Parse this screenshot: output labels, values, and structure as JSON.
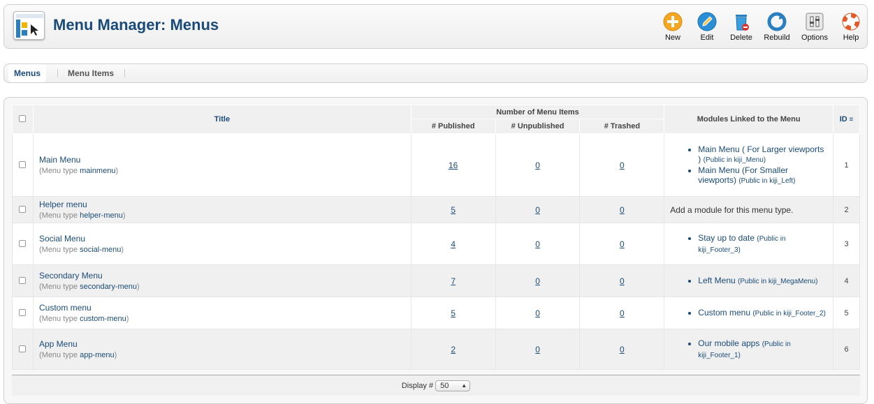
{
  "header": {
    "title": "Menu Manager: Menus",
    "logo_icon": "menu-manager-icon",
    "toolbar": [
      {
        "id": "new",
        "label": "New",
        "icon": "plus-circle-icon",
        "color": "#f39c12"
      },
      {
        "id": "edit",
        "label": "Edit",
        "icon": "pencil-icon",
        "color": "#2a8fd6"
      },
      {
        "id": "delete",
        "label": "Delete",
        "icon": "trash-icon",
        "color": "#3a8dd0"
      },
      {
        "id": "rebuild",
        "label": "Rebuild",
        "icon": "refresh-icon",
        "color": "#2a7fc0"
      },
      {
        "id": "options",
        "label": "Options",
        "icon": "options-icon",
        "color": "#888888"
      },
      {
        "id": "help",
        "label": "Help",
        "icon": "lifebuoy-icon",
        "color": "#e05a2a"
      }
    ]
  },
  "submenu": {
    "tabs": [
      {
        "label": "Menus",
        "active": true
      },
      {
        "label": "Menu Items",
        "active": false
      }
    ]
  },
  "table": {
    "headers": {
      "title": "Title",
      "group": "Number of Menu Items",
      "published": "# Published",
      "unpublished": "# Unpublished",
      "trashed": "# Trashed",
      "modules": "Modules Linked to the Menu",
      "id": "ID"
    },
    "type_prefix": "Menu type",
    "rows": [
      {
        "title": "Main Menu",
        "type": "mainmenu",
        "published": "16",
        "unpublished": "0",
        "trashed": "0",
        "modules": [
          {
            "name": "Main Menu ( For Larger viewports )",
            "note": "(Public in kiji_Menu)"
          },
          {
            "name": "Main Menu (For Smaller viewports)",
            "note": "(Public in kiji_Left)"
          }
        ],
        "id": "1"
      },
      {
        "title": "Helper menu",
        "type": "helper-menu",
        "published": "5",
        "unpublished": "0",
        "trashed": "0",
        "add_module": "Add a module for this menu type.",
        "modules": [],
        "id": "2"
      },
      {
        "title": "Social Menu",
        "type": "social-menu",
        "published": "4",
        "unpublished": "0",
        "trashed": "0",
        "modules": [
          {
            "name": "Stay up to date",
            "note": "(Public in kiji_Footer_3)"
          }
        ],
        "id": "3"
      },
      {
        "title": "Secondary Menu",
        "type": "secondary-menu",
        "published": "7",
        "unpublished": "0",
        "trashed": "0",
        "modules": [
          {
            "name": "Left Menu",
            "note": "(Public in kiji_MegaMenu)"
          }
        ],
        "id": "4"
      },
      {
        "title": "Custom menu",
        "type": "custom-menu",
        "published": "5",
        "unpublished": "0",
        "trashed": "0",
        "modules": [
          {
            "name": "Custom menu",
            "note": "(Public in kiji_Footer_2)"
          }
        ],
        "id": "5"
      },
      {
        "title": "App Menu",
        "type": "app-menu",
        "published": "2",
        "unpublished": "0",
        "trashed": "0",
        "modules": [
          {
            "name": "Our mobile apps",
            "note": "(Public in kiji_Footer_1)"
          }
        ],
        "id": "6"
      }
    ]
  },
  "footer": {
    "display_label": "Display #",
    "display_value": "50"
  }
}
